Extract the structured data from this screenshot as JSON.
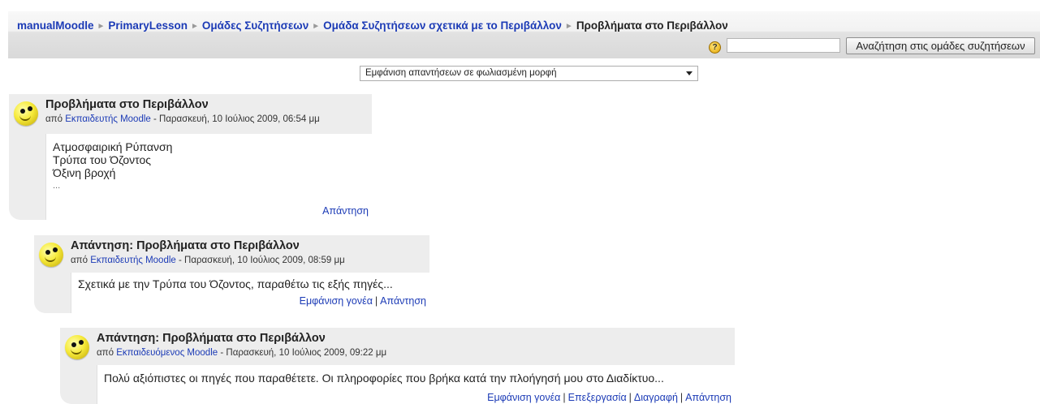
{
  "breadcrumb": [
    {
      "label": "manualMoodle",
      "link": true
    },
    {
      "label": "PrimaryLesson",
      "link": true
    },
    {
      "label": "Ομάδες Συζητήσεων",
      "link": true
    },
    {
      "label": "Ομάδα Συζητήσεων σχετικά με το Περιβάλλον",
      "link": true
    },
    {
      "label": "Προβλήματα στο Περιβάλλον",
      "link": false
    }
  ],
  "search": {
    "value": "",
    "button_label": "Αναζήτηση στις ομάδες συζητήσεων",
    "help_icon": "help-icon",
    "help_glyph": "?"
  },
  "display_mode": {
    "selected": "Εμφάνιση απαντήσεων σε φωλιασμένη μορφή"
  },
  "posts": [
    {
      "subject": "Προβλήματα στο Περιβάλλον",
      "by_prefix": "από",
      "author": "Εκπαιδευτής Moodle",
      "date": "- Παρασκευή, 10 Ιούλιος 2009, 06:54 μμ",
      "message_lines": [
        "Ατμοσφαιρική Ρύπανση",
        "Τρύπα του Όζοντος",
        "Όξινη βροχή",
        "..."
      ],
      "commands": [
        "Απάντηση"
      ]
    },
    {
      "subject": "Απάντηση: Προβλήματα στο Περιβάλλον",
      "by_prefix": "από",
      "author": "Εκπαιδευτής Moodle",
      "date": "- Παρασκευή, 10 Ιούλιος 2009, 08:59 μμ",
      "message_lines": [
        "Σχετικά με την Τρύπα του Όζοντος, παραθέτω τις εξής πηγές..."
      ],
      "commands": [
        "Εμφάνιση γονέα",
        "Απάντηση"
      ]
    },
    {
      "subject": "Απάντηση: Προβλήματα στο Περιβάλλον",
      "by_prefix": "από",
      "author": "Εκπαιδευόμενος Moodle",
      "date": "- Παρασκευή, 10 Ιούλιος 2009, 09:22 μμ",
      "message_lines": [
        "Πολύ αξιόπιστες οι πηγές που παραθέτετε. Οι πληροφορίες που βρήκα κατά την πλοήγησή μου στο Διαδίκτυο..."
      ],
      "commands": [
        "Εμφάνιση γονέα",
        "Επεξεργασία",
        "Διαγραφή",
        "Απάντηση"
      ]
    }
  ]
}
